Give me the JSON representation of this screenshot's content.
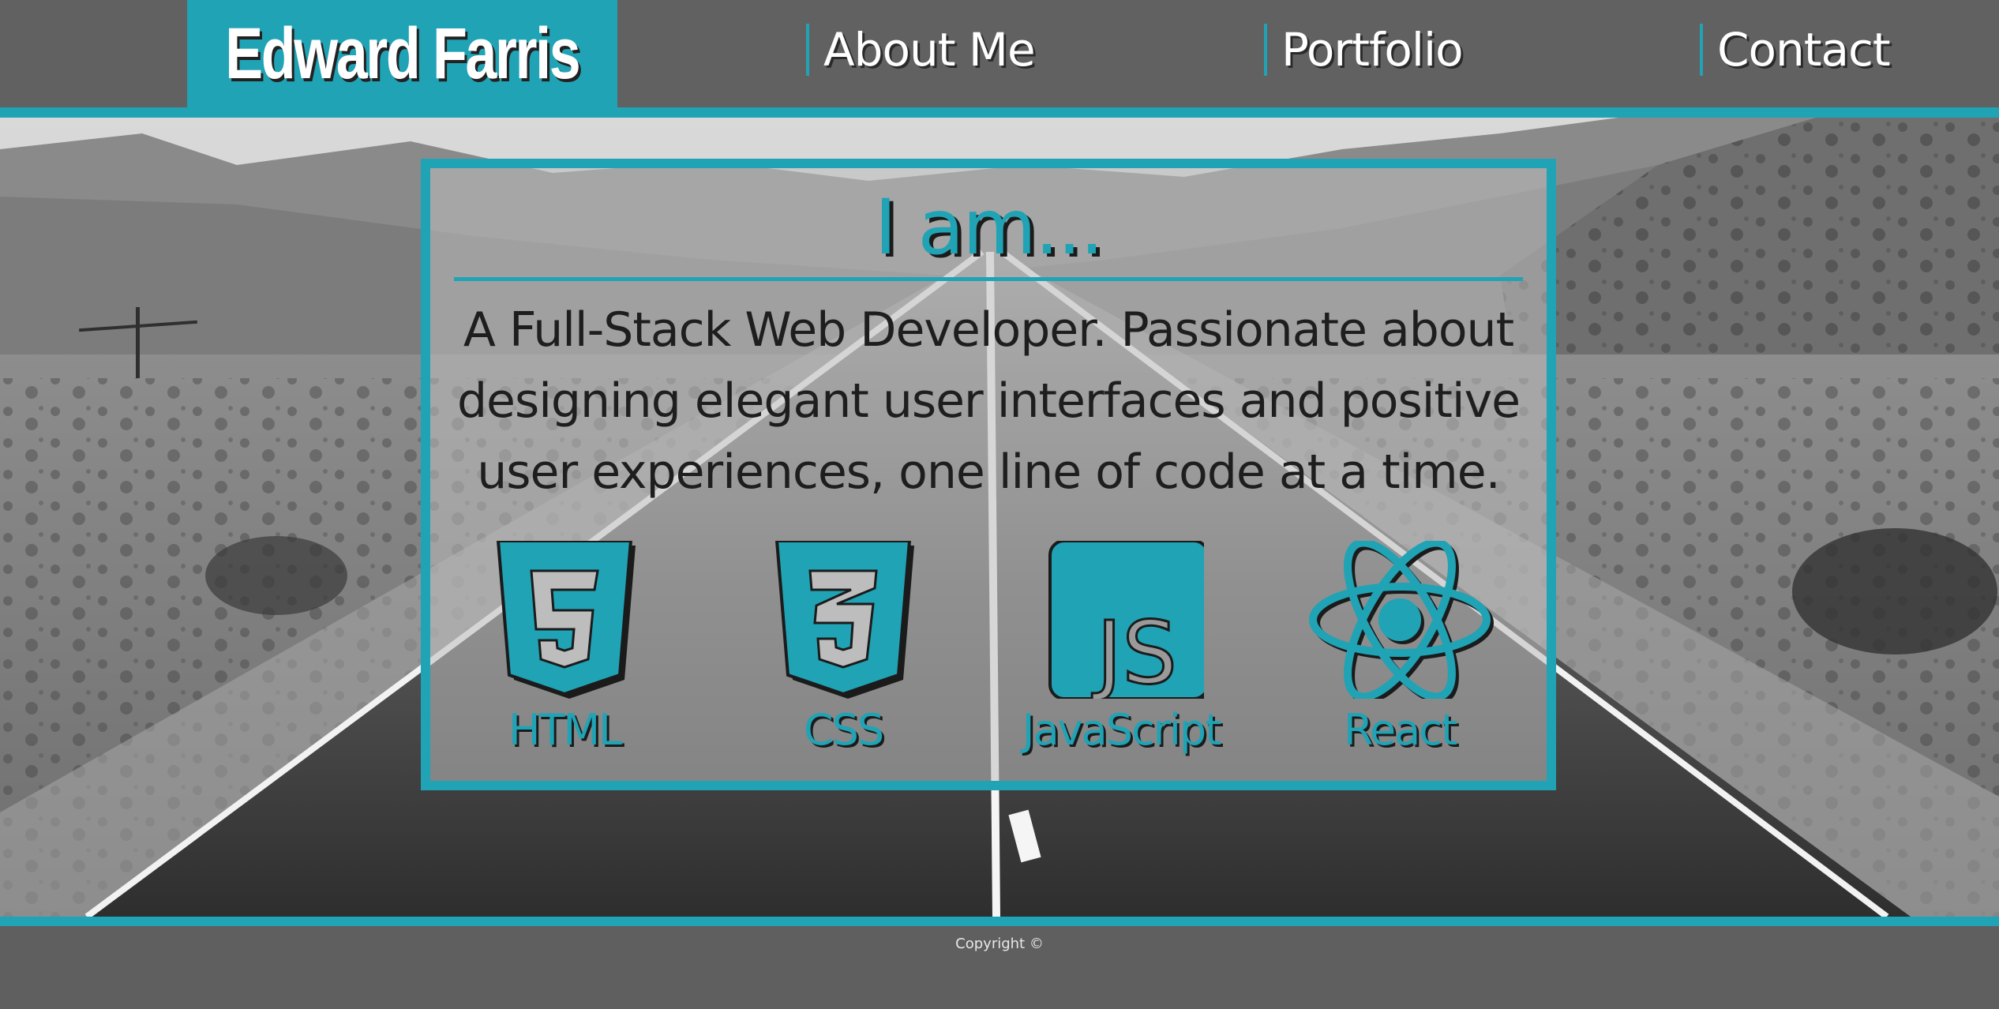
{
  "header": {
    "brand": "Edward Farris",
    "nav": [
      {
        "label": "About Me"
      },
      {
        "label": "Portfolio"
      },
      {
        "label": "Contact"
      }
    ]
  },
  "hero": {
    "title": "I am...",
    "description": "A Full-Stack Web Developer. Passionate about designing elegant user interfaces and positive user experiences, one line of code at a time.",
    "skills": [
      {
        "label": "HTML",
        "icon": "html5-icon"
      },
      {
        "label": "CSS",
        "icon": "css3-icon"
      },
      {
        "label": "JavaScript",
        "icon": "javascript-icon",
        "badge": "JS"
      },
      {
        "label": "React",
        "icon": "react-icon"
      }
    ]
  },
  "footer": {
    "copyright": "Copyright ©"
  },
  "colors": {
    "accent": "#1fa3b5",
    "header_bg": "#616161",
    "footer_bg": "#5f5f5f"
  }
}
